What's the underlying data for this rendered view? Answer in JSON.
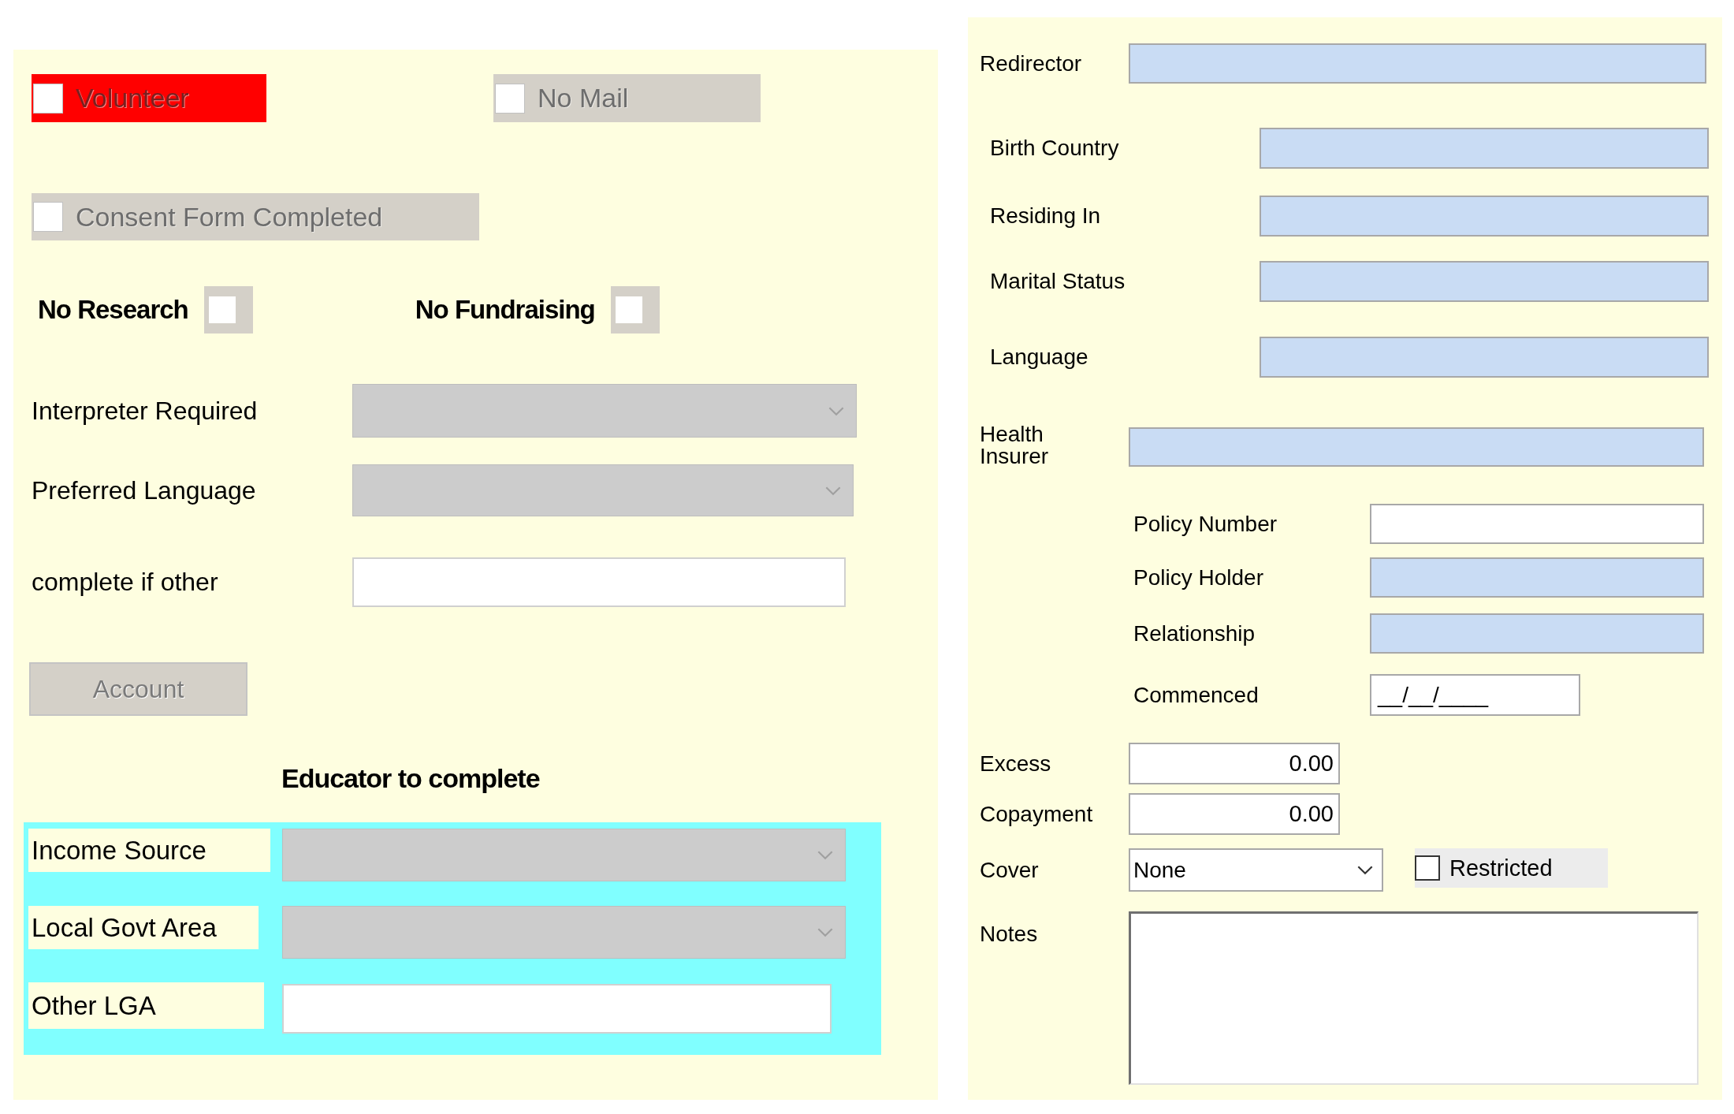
{
  "left_panel": {
    "flags": [
      {
        "label": "Volunteer",
        "checked": false,
        "disabled": true,
        "color": "#ff0000"
      },
      {
        "label": "No Mail",
        "checked": false,
        "disabled": true,
        "color": "#d4d0c8"
      }
    ],
    "consent": {
      "label": "Consent Form Completed",
      "checked": false,
      "disabled": true
    },
    "opt_outs": [
      {
        "label": "No Research",
        "checked": false
      },
      {
        "label": "No Fundraising",
        "checked": false
      }
    ],
    "fields": [
      {
        "kind": "dropdown",
        "label": "Interpreter Required",
        "disabled": true
      },
      {
        "kind": "dropdown",
        "label": "Preferred Language",
        "disabled": true
      },
      {
        "kind": "text",
        "label": "complete if other",
        "disabled": false
      }
    ],
    "account_button": {
      "label": "Account",
      "disabled": true
    },
    "educator_section": {
      "title": "Educator to complete",
      "fields": [
        {
          "kind": "dropdown",
          "label": "Income Source",
          "disabled": true
        },
        {
          "kind": "dropdown",
          "label": "Local Govt Area",
          "disabled": true
        },
        {
          "kind": "text",
          "label": "Other LGA",
          "disabled": false
        }
      ]
    }
  },
  "right_panel": {
    "redirector": {
      "label": "Redirector",
      "readonly": true
    },
    "residence_fields": [
      {
        "label": "Birth Country",
        "readonly": true
      },
      {
        "label": "Residing In",
        "readonly": true
      },
      {
        "label": "Marital Status",
        "readonly": true
      },
      {
        "label": "Language",
        "readonly": true
      }
    ],
    "health_insurer": {
      "label": "Health Insurer",
      "readonly": true
    },
    "policy_fields": [
      {
        "kind": "text",
        "label": "Policy Number",
        "readonly": false
      },
      {
        "kind": "text",
        "label": "Policy Holder",
        "readonly": true
      },
      {
        "kind": "text",
        "label": "Relationship",
        "readonly": true
      },
      {
        "kind": "date",
        "label": "Commenced",
        "readonly": false,
        "value": "__/__/____"
      }
    ],
    "amounts": [
      {
        "label": "Excess",
        "value": "0.00"
      },
      {
        "label": "Copayment",
        "value": "0.00"
      }
    ],
    "cover": {
      "label": "Cover",
      "value": "None",
      "restricted": {
        "label": "Restricted",
        "checked": false
      }
    },
    "notes": {
      "label": "Notes"
    }
  }
}
